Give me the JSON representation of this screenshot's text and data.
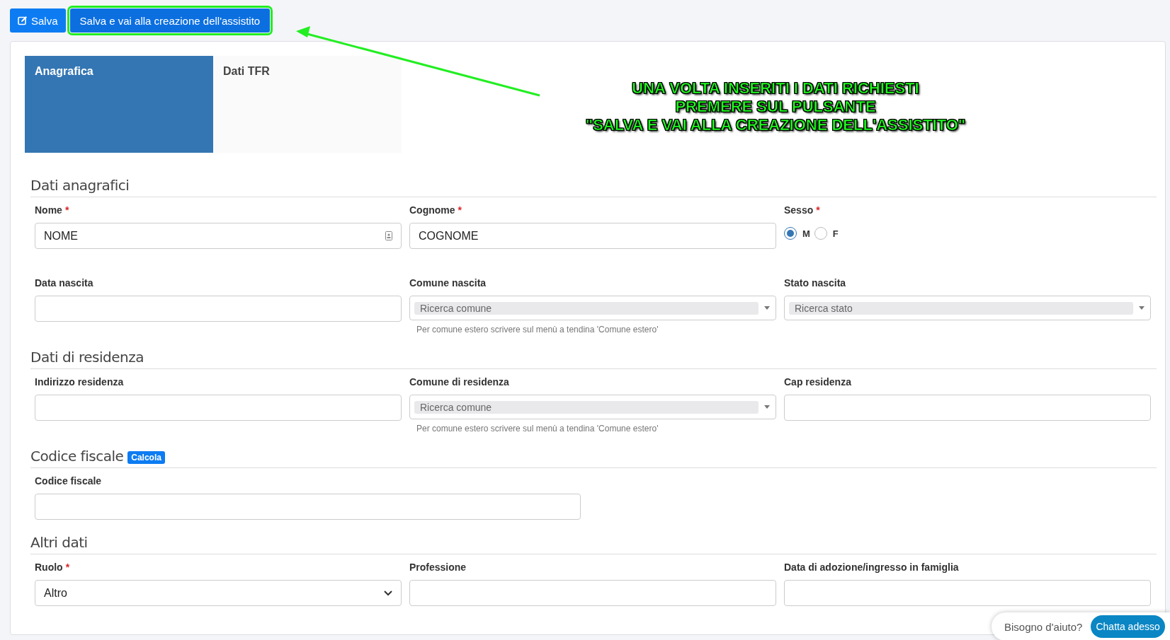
{
  "toolbar": {
    "buttons": [
      {
        "label": "Salva",
        "kind": "icon",
        "highlighted": false
      },
      {
        "label": "Salva e vai alla creazione dell'assistito",
        "kind": "plain",
        "highlighted": true
      }
    ]
  },
  "annotation": {
    "lines": [
      "UNA VOLTA INSERITI I DATI RICHIESTI",
      "PREMERE SUL PULSANTE",
      "\"SALVA E VAI ALLA CREAZIONE DELL'ASSISTITO\""
    ]
  },
  "tabs": [
    {
      "label": "Anagrafica",
      "selected": true
    },
    {
      "label": "Dati TFR",
      "selected": false
    }
  ],
  "sections": [
    {
      "title": "Dati anagrafici",
      "fields": [
        {
          "label": "Nome",
          "required_mark": "*",
          "kind": "text",
          "value": "NOME",
          "contact_icon": true
        },
        {
          "label": "Cognome",
          "required_mark": "*",
          "kind": "text",
          "value": "COGNOME"
        },
        {
          "label": "Sesso",
          "required_mark": "*",
          "kind": "radio",
          "options": [
            {
              "label": "M",
              "selected": true
            },
            {
              "label": "F",
              "selected": false
            }
          ]
        },
        {
          "label": "Data nascita",
          "kind": "text"
        },
        {
          "label": "Comune nascita",
          "kind": "search-select",
          "placeholder": "Ricerca comune",
          "hint": "Per comune estero scrivere sul menù a tendina 'Comune estero'"
        },
        {
          "label": "Stato nascita",
          "kind": "search-select",
          "placeholder": "Ricerca stato"
        }
      ]
    },
    {
      "title": "Dati di residenza",
      "fields": [
        {
          "label": "Indirizzo residenza",
          "kind": "text"
        },
        {
          "label": "Comune di residenza",
          "kind": "search-select",
          "placeholder": "Ricerca comune",
          "hint": "Per comune estero scrivere sul menù a tendina 'Comune estero'"
        },
        {
          "label": "Cap residenza",
          "kind": "text"
        }
      ]
    },
    {
      "title": "Codice fiscale",
      "badge": "Calcola",
      "fields": [
        {
          "label": "Codice fiscale",
          "kind": "text"
        }
      ]
    },
    {
      "title": "Altri dati",
      "fields": [
        {
          "label": "Ruolo",
          "required_mark": "*",
          "kind": "select",
          "value": "Altro"
        },
        {
          "label": "Professione",
          "kind": "text"
        },
        {
          "label": "Data di adozione/ingresso in famiglia",
          "kind": "text"
        }
      ]
    }
  ],
  "chat": {
    "question": "Bisogno d'aiuto?",
    "button": "Chatta adesso"
  }
}
